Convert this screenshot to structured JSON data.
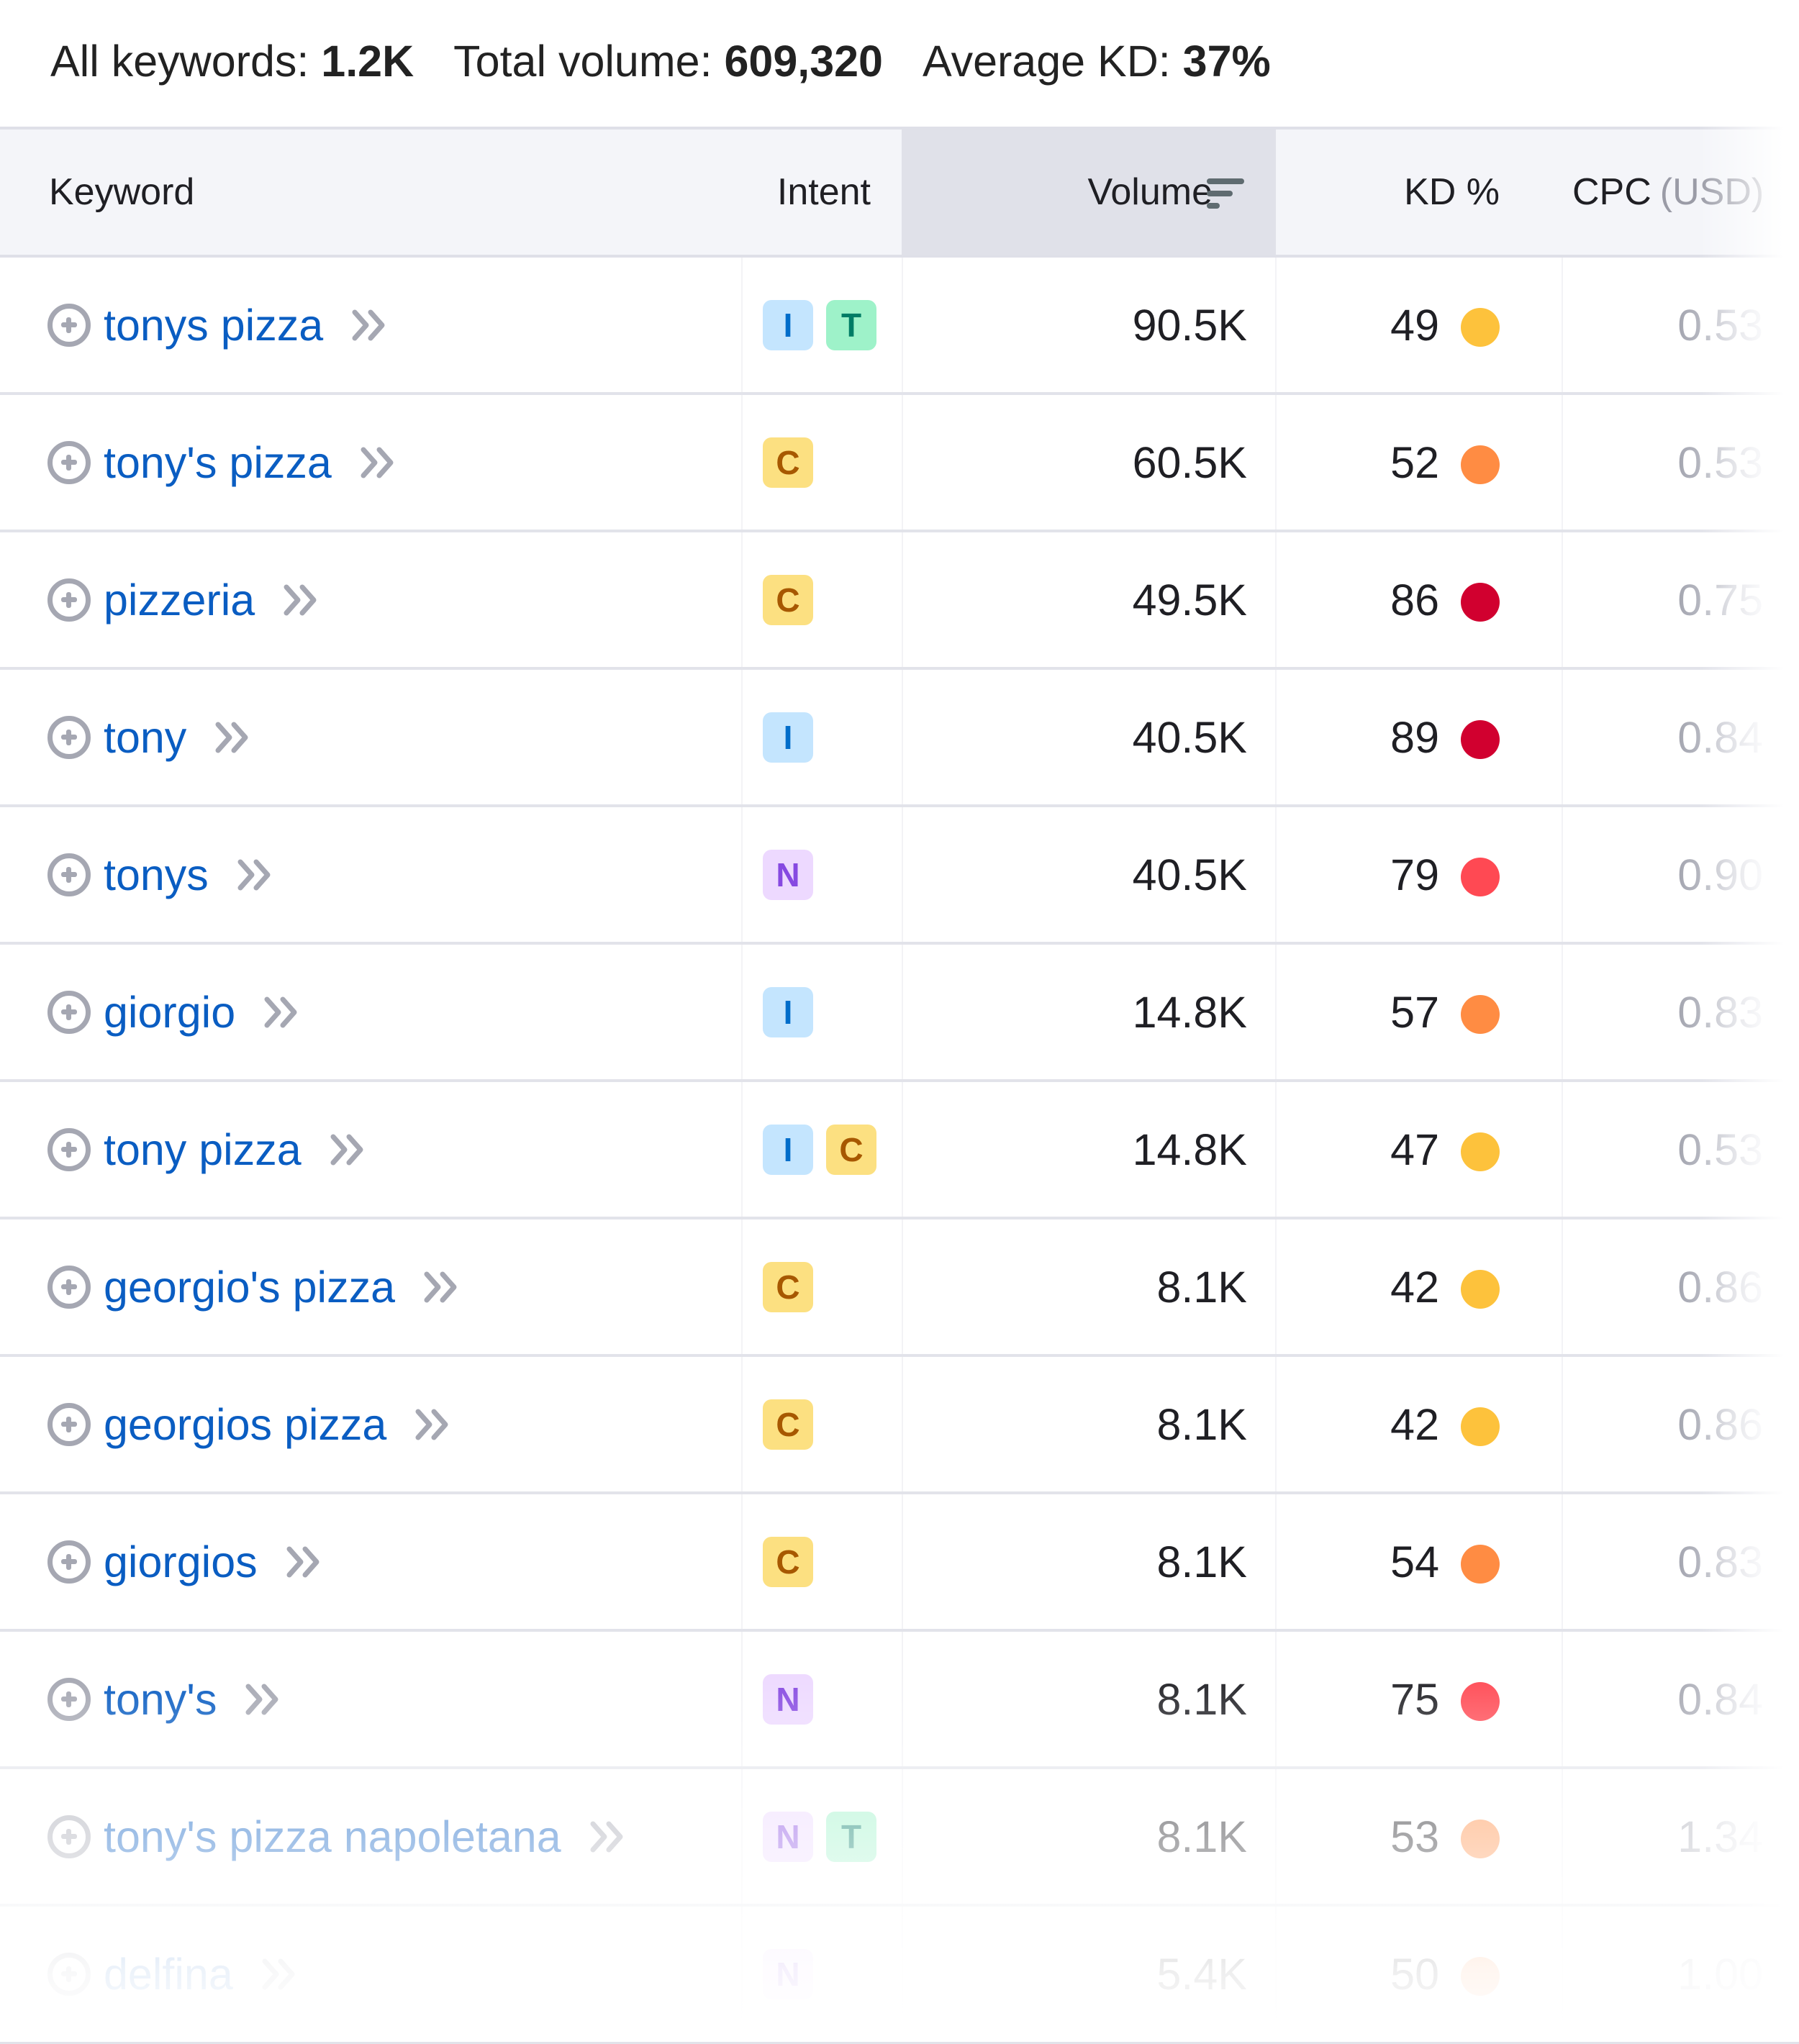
{
  "summary": {
    "all_keywords_label": "All keywords:",
    "all_keywords_value": "1.2K",
    "total_volume_label": "Total volume:",
    "total_volume_value": "609,320",
    "average_kd_label": "Average KD:",
    "average_kd_value": "37%"
  },
  "columns": {
    "keyword": "Keyword",
    "intent": "Intent",
    "volume": "Volume",
    "kd": "KD %",
    "cpc": "CPC",
    "cpc_unit": "(USD)",
    "sort_icon": "sort-descending-icon"
  },
  "colors": {
    "link": "#0a5dc2",
    "intent": {
      "I": {
        "bg": "#c4e5fe",
        "fg": "#006dca"
      },
      "T": {
        "bg": "#9ef2c9",
        "fg": "#007c65"
      },
      "C": {
        "bg": "#fce081",
        "fg": "#a75800"
      },
      "N": {
        "bg": "#edd9ff",
        "fg": "#8649e1"
      }
    },
    "kd_levels": {
      "possible": "#fdc23c",
      "difficult": "#ff8c43",
      "hard": "#ff4953",
      "very_hard": "#d1002f"
    }
  },
  "rows": [
    {
      "keyword": "tonys pizza",
      "intents": [
        "I",
        "T"
      ],
      "volume": "90.5K",
      "kd": "49",
      "kd_color": "#fdc23c",
      "cpc": "0.53"
    },
    {
      "keyword": "tony's pizza",
      "intents": [
        "C"
      ],
      "volume": "60.5K",
      "kd": "52",
      "kd_color": "#ff8c43",
      "cpc": "0.53"
    },
    {
      "keyword": "pizzeria",
      "intents": [
        "C"
      ],
      "volume": "49.5K",
      "kd": "86",
      "kd_color": "#d1002f",
      "cpc": "0.75"
    },
    {
      "keyword": "tony",
      "intents": [
        "I"
      ],
      "volume": "40.5K",
      "kd": "89",
      "kd_color": "#d1002f",
      "cpc": "0.84"
    },
    {
      "keyword": "tonys",
      "intents": [
        "N"
      ],
      "volume": "40.5K",
      "kd": "79",
      "kd_color": "#ff4953",
      "cpc": "0.90"
    },
    {
      "keyword": "giorgio",
      "intents": [
        "I"
      ],
      "volume": "14.8K",
      "kd": "57",
      "kd_color": "#ff8c43",
      "cpc": "0.83"
    },
    {
      "keyword": "tony pizza",
      "intents": [
        "I",
        "C"
      ],
      "volume": "14.8K",
      "kd": "47",
      "kd_color": "#fdc23c",
      "cpc": "0.53"
    },
    {
      "keyword": "georgio's pizza",
      "intents": [
        "C"
      ],
      "volume": "8.1K",
      "kd": "42",
      "kd_color": "#fdc23c",
      "cpc": "0.86"
    },
    {
      "keyword": "georgios pizza",
      "intents": [
        "C"
      ],
      "volume": "8.1K",
      "kd": "42",
      "kd_color": "#fdc23c",
      "cpc": "0.86"
    },
    {
      "keyword": "giorgios",
      "intents": [
        "C"
      ],
      "volume": "8.1K",
      "kd": "54",
      "kd_color": "#ff8c43",
      "cpc": "0.83"
    },
    {
      "keyword": "tony's",
      "intents": [
        "N"
      ],
      "volume": "8.1K",
      "kd": "75",
      "kd_color": "#ff4953",
      "cpc": "0.84"
    },
    {
      "keyword": "tony's pizza napoletana",
      "intents": [
        "N",
        "T"
      ],
      "volume": "8.1K",
      "kd": "53",
      "kd_color": "#ff8c43",
      "cpc": "1.34"
    },
    {
      "keyword": "delfina",
      "intents": [
        "N"
      ],
      "volume": "5.4K",
      "kd": "50",
      "kd_color": "#ff8c43",
      "cpc": "1.00"
    }
  ]
}
